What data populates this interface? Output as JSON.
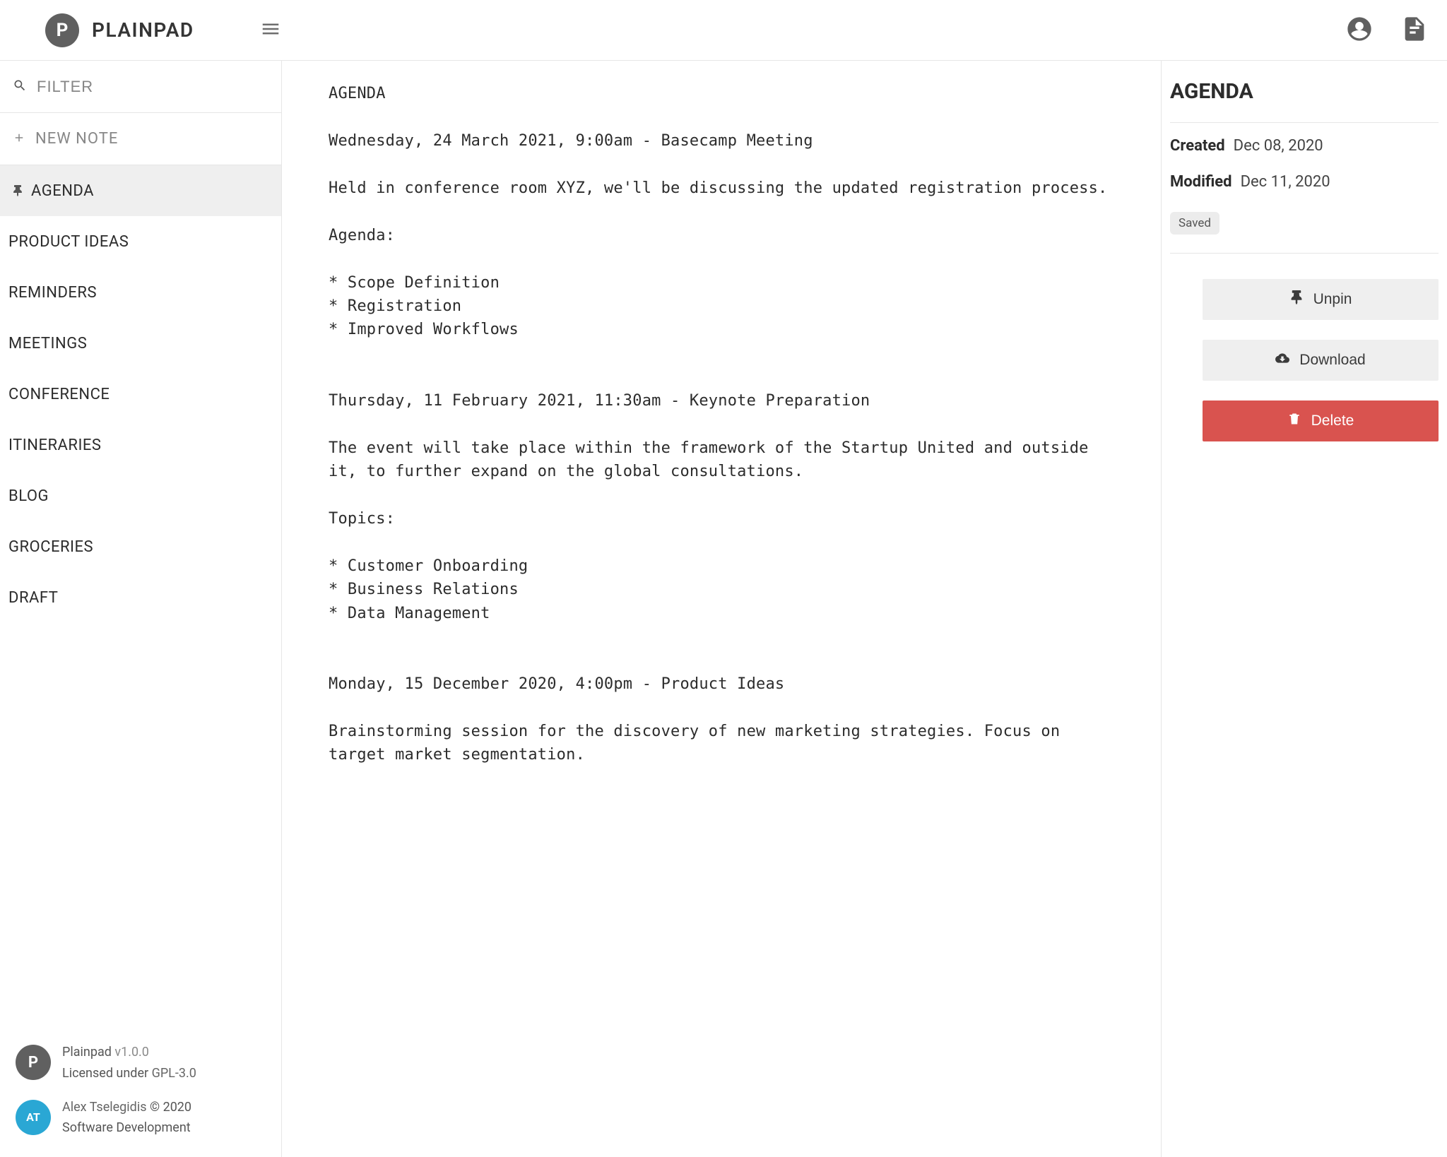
{
  "header": {
    "brand_name": "PLAINPAD",
    "logo_letter": "P"
  },
  "sidebar": {
    "filter_placeholder": "FILTER",
    "new_note_label": "NEW NOTE",
    "notes": [
      {
        "title": "AGENDA",
        "pinned": true,
        "active": true
      },
      {
        "title": "PRODUCT IDEAS",
        "pinned": false,
        "active": false
      },
      {
        "title": "REMINDERS",
        "pinned": false,
        "active": false
      },
      {
        "title": "MEETINGS",
        "pinned": false,
        "active": false
      },
      {
        "title": "CONFERENCE",
        "pinned": false,
        "active": false
      },
      {
        "title": "ITINERARIES",
        "pinned": false,
        "active": false
      },
      {
        "title": "BLOG",
        "pinned": false,
        "active": false
      },
      {
        "title": "GROCERIES",
        "pinned": false,
        "active": false
      },
      {
        "title": "DRAFT",
        "pinned": false,
        "active": false
      }
    ],
    "footer": {
      "app_name": "Plainpad",
      "app_version": "v1.0.0",
      "licensed_label": "Licensed under",
      "license_name": "GPL-3.0",
      "author": "Alex Tselegidis",
      "copyright": "© 2020",
      "author_sub": "Software Development",
      "at_text": "AT"
    }
  },
  "editor": {
    "content": "AGENDA\n\nWednesday, 24 March 2021, 9:00am - Basecamp Meeting\n\nHeld in conference room XYZ, we'll be discussing the updated registration process.\n\nAgenda:\n\n* Scope Definition\n* Registration\n* Improved Workflows\n\n\nThursday, 11 February 2021, 11:30am - Keynote Preparation\n\nThe event will take place within the framework of the Startup United and outside it, to further expand on the global consultations.\n\nTopics:\n\n* Customer Onboarding\n* Business Relations\n* Data Management\n\n\nMonday, 15 December 2020, 4:00pm - Product Ideas\n\nBrainstorming session for the discovery of new marketing strategies. Focus on target market segmentation."
  },
  "info": {
    "title": "AGENDA",
    "created_label": "Created",
    "created_value": "Dec 08, 2020",
    "modified_label": "Modified",
    "modified_value": "Dec 11, 2020",
    "status_badge": "Saved",
    "actions": {
      "unpin": "Unpin",
      "download": "Download",
      "delete": "Delete"
    }
  }
}
